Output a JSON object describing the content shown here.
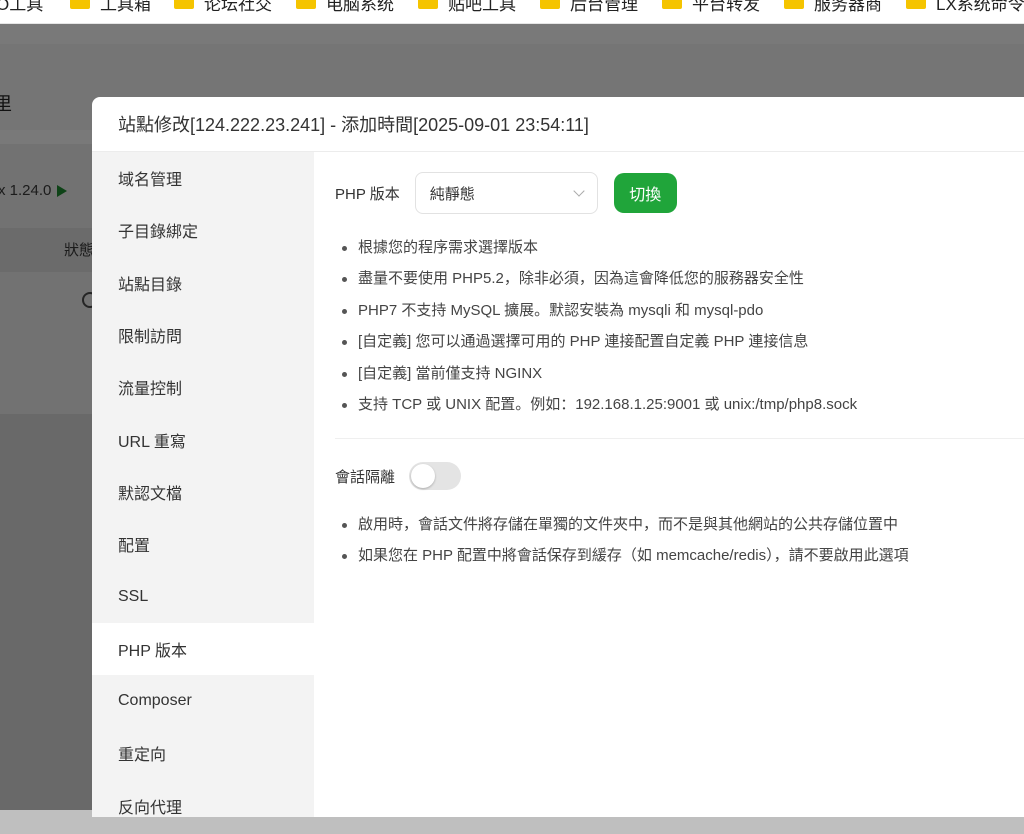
{
  "bookmarks": [
    {
      "label": "O工具"
    },
    {
      "label": "工具箱"
    },
    {
      "label": "论坛社交"
    },
    {
      "label": "电脑系统"
    },
    {
      "label": "贴吧工具"
    },
    {
      "label": "后台管理"
    },
    {
      "label": "平台转发"
    },
    {
      "label": "服务器商"
    },
    {
      "label": "LX系统命令"
    }
  ],
  "background_app": {
    "title_fragment": "里",
    "version_fragment": "x 1.24.0",
    "status_header": "狀態"
  },
  "modal": {
    "title": "站點修改[124.222.23.241] - 添加時間[2025-09-01 23:54:11]",
    "sidebar": [
      {
        "label": "域名管理"
      },
      {
        "label": "子目錄綁定"
      },
      {
        "label": "站點目錄"
      },
      {
        "label": "限制訪問"
      },
      {
        "label": "流量控制"
      },
      {
        "label": "URL 重寫"
      },
      {
        "label": "默認文檔"
      },
      {
        "label": "配置"
      },
      {
        "label": "SSL"
      },
      {
        "label": "PHP 版本"
      },
      {
        "label": "Composer"
      },
      {
        "label": "重定向"
      },
      {
        "label": "反向代理"
      }
    ],
    "active_item": "PHP 版本",
    "php": {
      "label": "PHP 版本",
      "selected": "純靜態",
      "switch_button": "切換",
      "tips": [
        "根據您的程序需求選擇版本",
        "盡量不要使用 PHP5.2，除非必須，因為這會降低您的服務器安全性",
        "PHP7 不支持 MySQL 擴展。默認安裝為 mysqli 和 mysql-pdo",
        "[自定義] 您可以通過選擇可用的 PHP 連接配置自定義 PHP 連接信息",
        "[自定義] 當前僅支持 NGINX",
        "支持 TCP 或 UNIX 配置。例如：192.168.1.25:9001 或 unix:/tmp/php8.sock"
      ]
    },
    "session": {
      "label": "會話隔離",
      "enabled": false,
      "tips": [
        "啟用時，會話文件將存儲在單獨的文件夾中，而不是與其他網站的公共存儲位置中",
        "如果您在 PHP 配置中將會話保存到緩存（如 memcache/redis），請不要啟用此選項"
      ]
    }
  },
  "colors": {
    "accent_green": "#20a53a",
    "folder_yellow": "#f5c400"
  }
}
